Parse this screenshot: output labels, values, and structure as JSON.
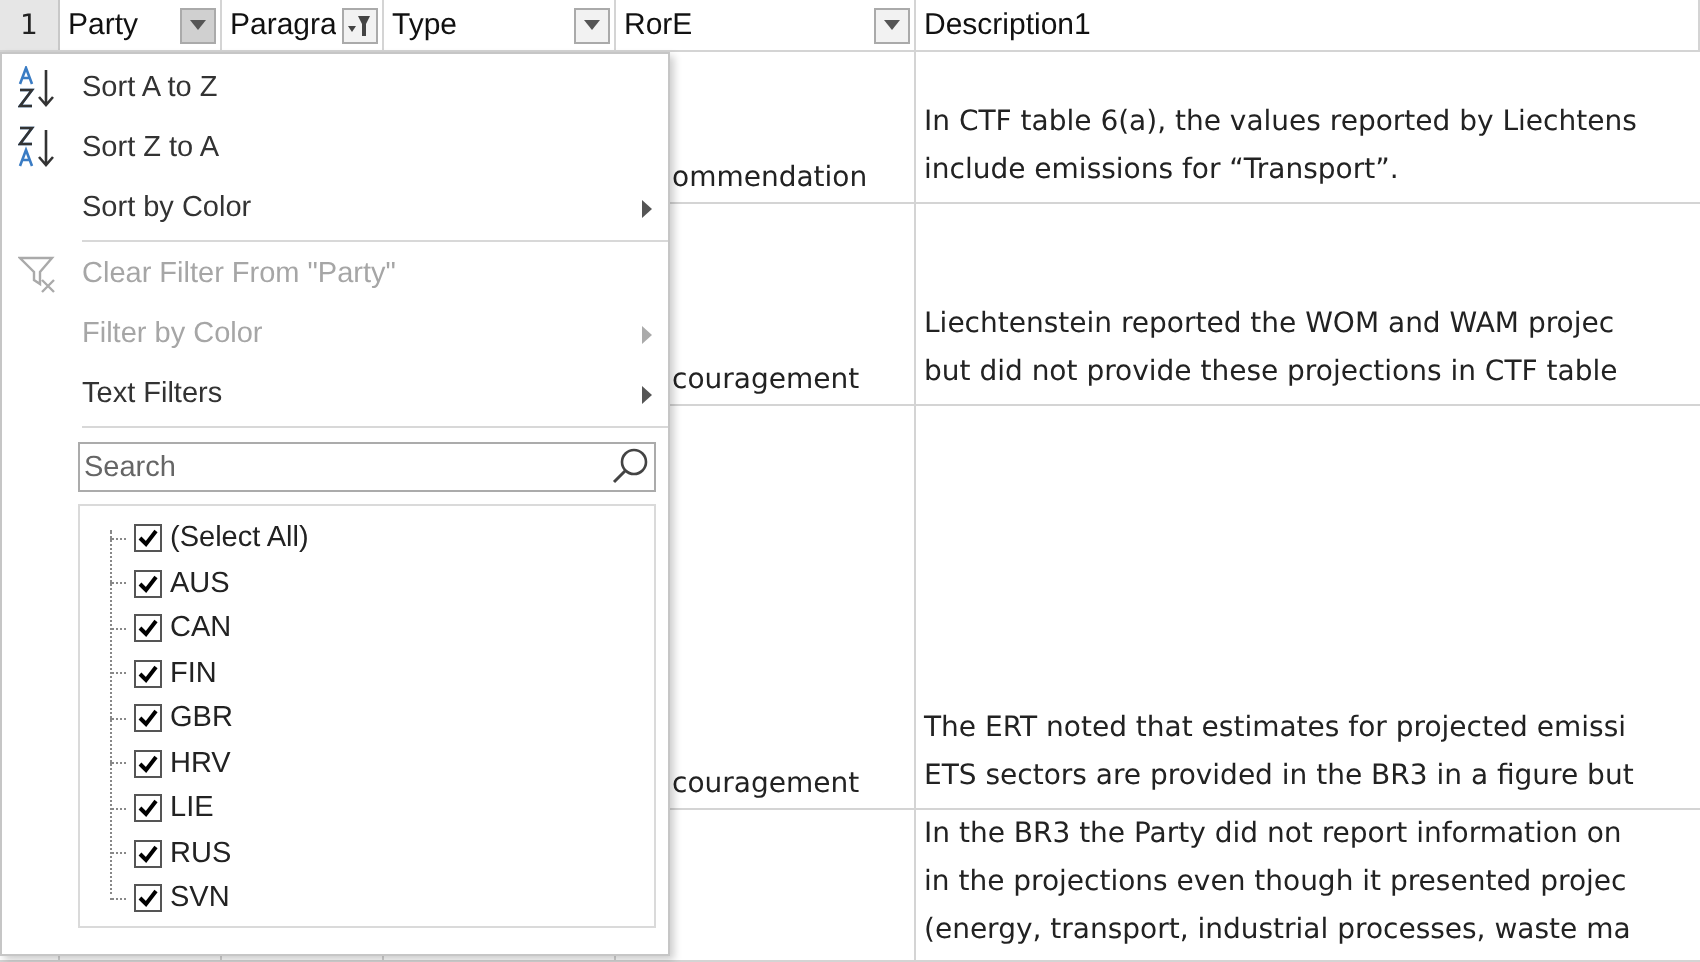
{
  "header": {
    "row_number": "1",
    "columns": [
      {
        "label": "Party",
        "kind": "open"
      },
      {
        "label": "Paragra",
        "kind": "filtered"
      },
      {
        "label": "Type",
        "kind": "dropdown"
      },
      {
        "label": "RorE",
        "kind": "dropdown"
      },
      {
        "label": "Description1",
        "kind": "plain"
      }
    ]
  },
  "rows": [
    {
      "ror_e": "ommendation",
      "description": [
        "In CTF table 6(a), the values reported by Liechtens",
        "include emissions for “Transport”."
      ]
    },
    {
      "ror_e": "couragement",
      "description": [
        "Liechtenstein reported the WOM and WAM projec",
        "but did not provide these projections in CTF table"
      ]
    },
    {
      "ror_e": "couragement",
      "description": [
        "The ERT noted that estimates for projected emissi",
        "ETS sectors are provided in the BR3 in a figure but"
      ]
    },
    {
      "ror_e": "",
      "description": [
        "In the BR3 the Party did not report information on",
        "in the projections even though it presented projec",
        "(energy, transport, industrial processes, waste ma"
      ]
    }
  ],
  "filter_menu": {
    "items": [
      {
        "label": "Sort A to Z",
        "kind": "sortaz",
        "disabled": false,
        "submenu": false,
        "separator_after": false
      },
      {
        "label": "Sort Z to A",
        "kind": "sortza",
        "disabled": false,
        "submenu": false,
        "separator_after": false
      },
      {
        "label": "Sort by Color",
        "kind": "plain",
        "disabled": false,
        "submenu": true,
        "separator_after": true
      },
      {
        "label": "Clear Filter From \"Party\"",
        "kind": "clear",
        "disabled": true,
        "submenu": false,
        "separator_after": false
      },
      {
        "label": "Filter by Color",
        "kind": "plain",
        "disabled": true,
        "submenu": true,
        "separator_after": false
      },
      {
        "label": "Text Filters",
        "kind": "plain",
        "disabled": false,
        "submenu": true,
        "separator_after": true
      }
    ],
    "search": {
      "placeholder": "Search"
    },
    "values": [
      {
        "label": "(Select All)",
        "checked": true
      },
      {
        "label": "AUS",
        "checked": true
      },
      {
        "label": "CAN",
        "checked": true
      },
      {
        "label": "FIN",
        "checked": true
      },
      {
        "label": "GBR",
        "checked": true
      },
      {
        "label": "HRV",
        "checked": true
      },
      {
        "label": "LIE",
        "checked": true
      },
      {
        "label": "RUS",
        "checked": true
      },
      {
        "label": "SVN",
        "checked": true
      }
    ]
  }
}
